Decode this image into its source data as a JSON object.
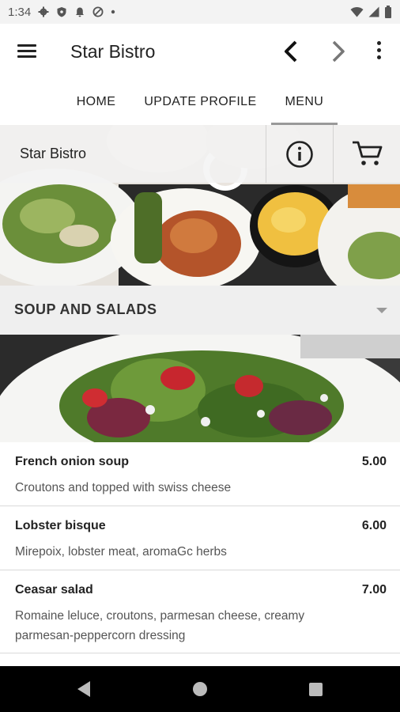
{
  "status_bar": {
    "time": "1:34",
    "icons": [
      "gear-icon",
      "shield-icon",
      "bell-icon",
      "at-sign-icon",
      "dot-icon",
      "wifi-icon",
      "signal-icon",
      "battery-icon"
    ]
  },
  "app_bar": {
    "title": "Star Bistro",
    "icons": [
      "menu-icon",
      "back-arrow-icon",
      "forward-arrow-icon",
      "more-vert-icon"
    ]
  },
  "tabs": [
    {
      "label": "HOME",
      "active": false
    },
    {
      "label": "UPDATE PROFILE",
      "active": false
    },
    {
      "label": "MENU",
      "active": true
    }
  ],
  "hero": {
    "restaurant_name": "Star Bistro",
    "icons": [
      "info-icon",
      "cart-icon"
    ]
  },
  "category": {
    "title": "SOUP AND SALADS",
    "icon": "dropdown-arrow-icon"
  },
  "menu_items": [
    {
      "name": "French onion soup",
      "price": "5.00",
      "description": "Croutons and topped with swiss cheese"
    },
    {
      "name": "Lobster bisque",
      "price": "6.00",
      "description": "Mirepoix, lobster meat, aromaGc herbs"
    },
    {
      "name": "Ceasar salad",
      "price": "7.00",
      "description": "Romaine leluce, croutons, parmesan cheese, creamy parmesan-peppercorn dressing"
    }
  ],
  "nav_bar": {
    "icons": [
      "back-triangle-icon",
      "home-circle-icon",
      "recents-square-icon"
    ]
  },
  "colors": {
    "status_bar_bg": "#f3f3f3",
    "category_bg": "#efefef",
    "divider": "#d9d9d9",
    "nav_bar_bg": "#000000"
  }
}
